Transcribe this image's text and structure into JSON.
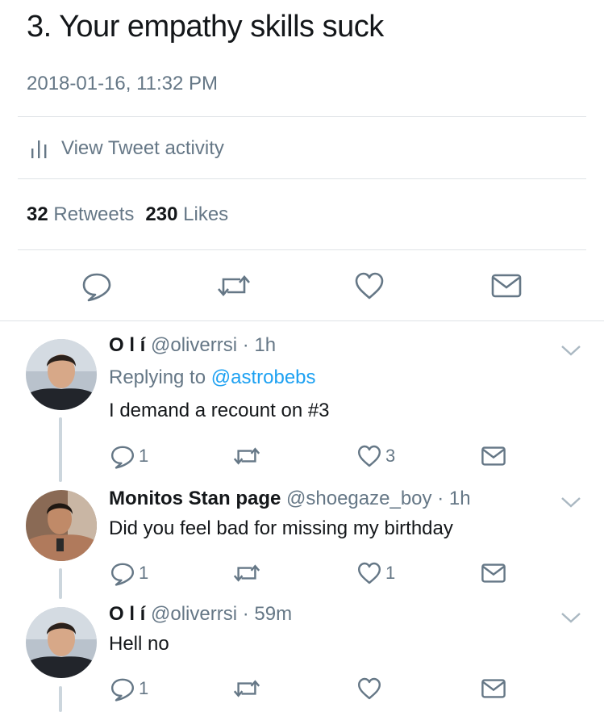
{
  "tweet": {
    "text": "3. Your empathy skills suck",
    "timestamp": "2018-01-16, 11:32 PM",
    "activity_label": "View Tweet activity",
    "retweets_count": "32",
    "retweets_label": "Retweets",
    "likes_count": "230",
    "likes_label": "Likes"
  },
  "icons": {
    "activity": "bar-chart-icon",
    "reply": "reply-icon",
    "retweet": "retweet-icon",
    "like": "heart-icon",
    "message": "envelope-icon",
    "menu": "chevron-down-icon"
  },
  "colors": {
    "text": "#14171a",
    "muted": "#657786",
    "link": "#1da1f2",
    "divider": "#dfe3e6",
    "thread": "#ccd6dd"
  },
  "replies": [
    {
      "name": "O l í",
      "handle": "@oliverrsi",
      "separator": "·",
      "time": "1h",
      "replying_prefix": "Replying to",
      "replying_to": "@astrobebs",
      "text": "I demand a recount on #3",
      "reply_count": "1",
      "retweet_count": "",
      "like_count": "3"
    },
    {
      "name": "Monitos Stan page",
      "handle": "@shoegaze_boy",
      "separator": "·",
      "time": "1h",
      "text": "Did you feel bad for missing my birthday",
      "reply_count": "1",
      "retweet_count": "",
      "like_count": "1"
    },
    {
      "name": "O l í",
      "handle": "@oliverrsi",
      "separator": "·",
      "time": "59m",
      "text": "Hell no",
      "reply_count": "1",
      "retweet_count": "",
      "like_count": ""
    }
  ]
}
